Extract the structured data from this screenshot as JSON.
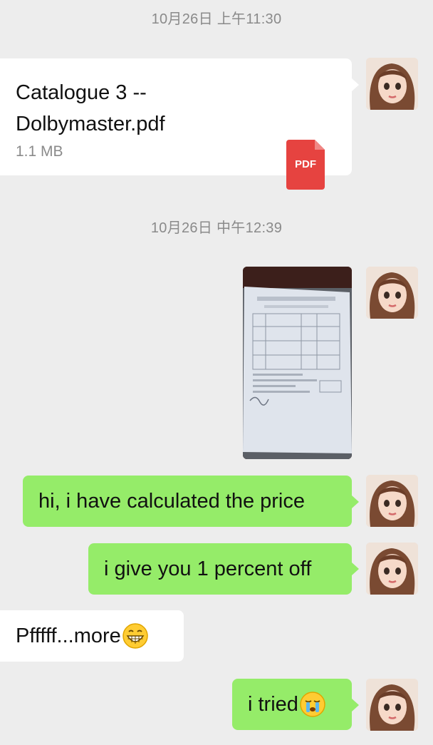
{
  "timestamps": [
    "10月26日 上午11:30",
    "10月26日 中午12:39"
  ],
  "file_message": {
    "name_line1": "Catalogue 3 --",
    "name_line2": "Dolbymaster.pdf",
    "size": "1.1 MB",
    "icon_label": "PDF"
  },
  "messages": {
    "m1": "hi, i have calculated the price",
    "m2": "i give you 1 percent off",
    "m3": "Pfffff...more",
    "m4": "i tried"
  },
  "icons": {
    "pdf": "pdf-file-icon",
    "grin": "grinning-face-emoji",
    "cry": "crying-face-emoji"
  },
  "colors": {
    "background": "#ededed",
    "sent_bubble": "#95ec69",
    "received_bubble": "#ffffff",
    "pdf_red": "#e64340",
    "timestamp": "#8a8a8a"
  }
}
